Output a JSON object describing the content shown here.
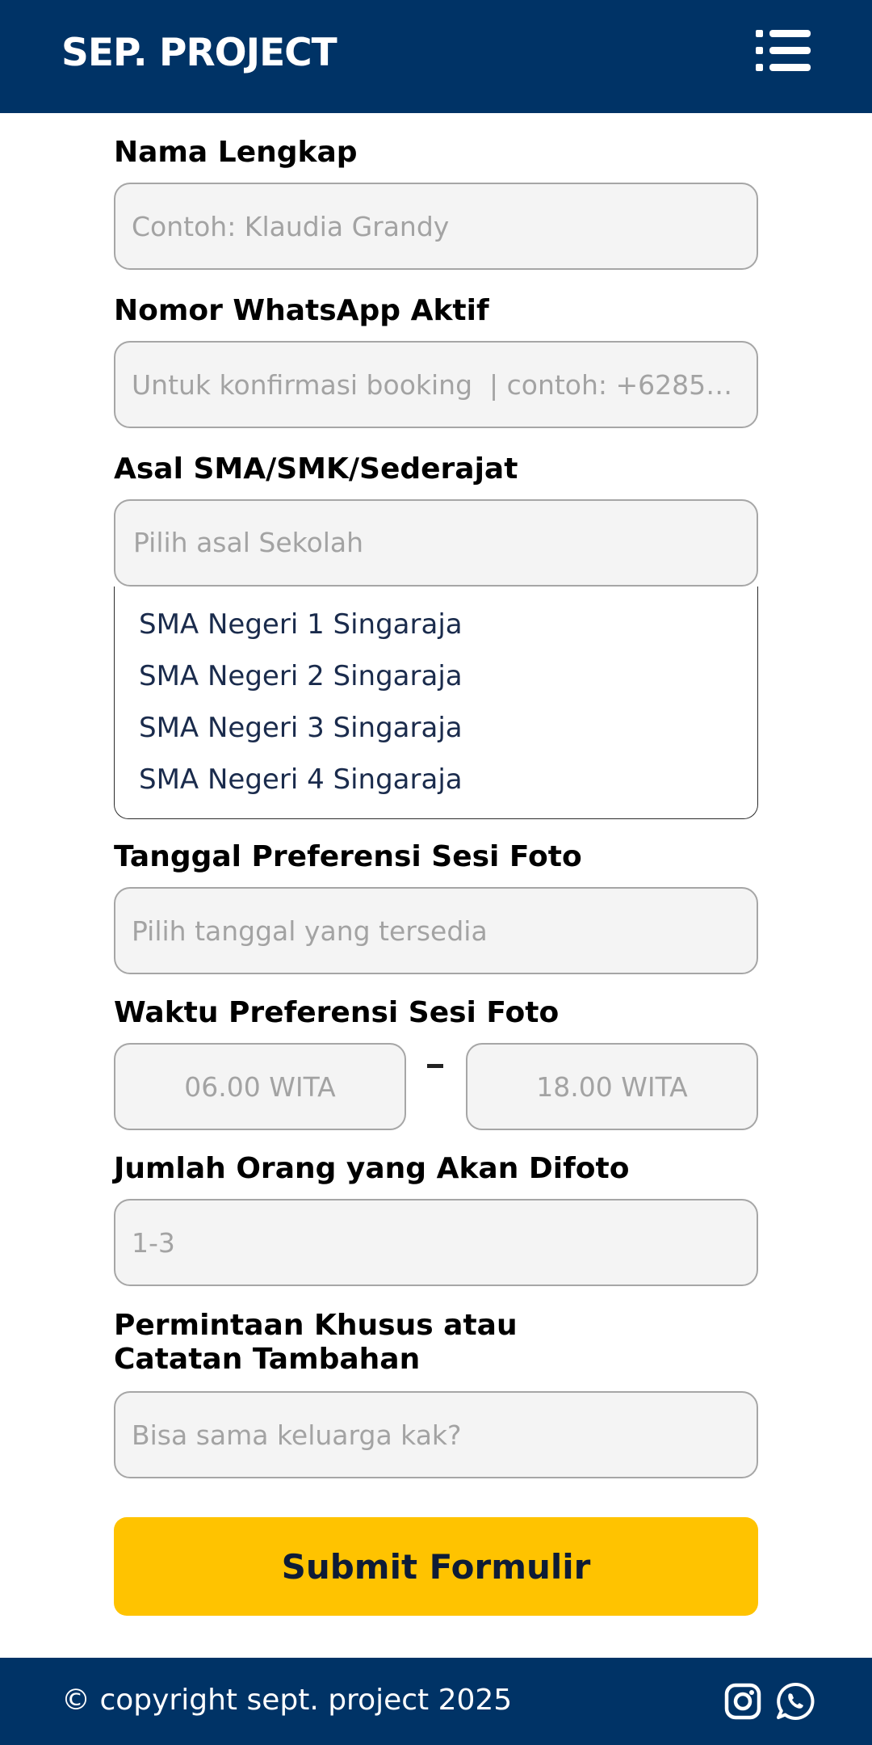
{
  "header": {
    "brand": "SEP. PROJECT",
    "menu_icon": "menu-list-icon"
  },
  "form": {
    "full_name": {
      "label": "Nama Lengkap",
      "placeholder": "Contoh: Klaudia Grandy"
    },
    "whatsapp": {
      "label": "Nomor WhatsApp Aktif",
      "placeholder": "Untuk konfirmasi booking  | contoh: +6285…"
    },
    "school": {
      "label": "Asal SMA/SMK/Sederajat",
      "placeholder": "Pilih asal Sekolah",
      "options": [
        "SMA Negeri 1 Singaraja",
        "SMA Negeri 2 Singaraja",
        "SMA Negeri 3 Singaraja",
        "SMA Negeri 4 Singaraja"
      ]
    },
    "date": {
      "label": "Tanggal Preferensi Sesi Foto",
      "placeholder": "Pilih tanggal yang tersedia"
    },
    "time": {
      "label": "Waktu Preferensi Sesi Foto",
      "start_placeholder": "06.00 WITA",
      "separator": "-",
      "end_placeholder": "18.00 WITA"
    },
    "people": {
      "label": "Jumlah Orang yang Akan Difoto",
      "placeholder": "1-3"
    },
    "notes": {
      "label_line1": "Permintaan Khusus atau",
      "label_line2": "Catatan Tambahan",
      "placeholder": "Bisa sama keluarga kak?"
    },
    "submit_label": "Submit Formulir"
  },
  "footer": {
    "copyright": "© copyright sept. project 2025",
    "icons": [
      "instagram-icon",
      "whatsapp-icon"
    ]
  },
  "colors": {
    "header_bg": "#003366",
    "accent": "#ffc300",
    "field_bg": "#f4f4f4",
    "option_text": "#1a2b4c"
  }
}
